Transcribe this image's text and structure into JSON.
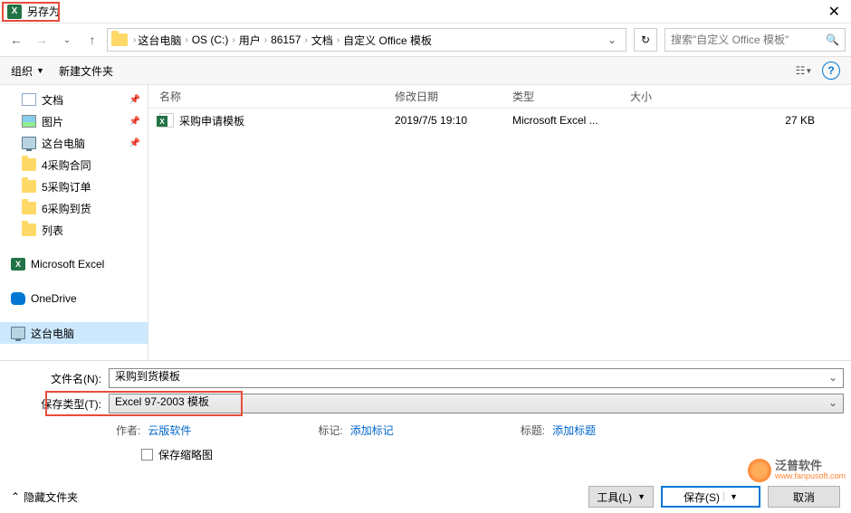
{
  "title": "另存为",
  "breadcrumb": [
    "这台电脑",
    "OS (C:)",
    "用户",
    "86157",
    "文档",
    "自定义 Office 模板"
  ],
  "search": {
    "placeholder": "搜索\"自定义 Office 模板\""
  },
  "toolbar": {
    "organize": "组织",
    "new_folder": "新建文件夹"
  },
  "sidebar": {
    "items": [
      {
        "label": "文档",
        "icon": "doc",
        "pinned": true
      },
      {
        "label": "图片",
        "icon": "pic",
        "pinned": true
      },
      {
        "label": "这台电脑",
        "icon": "pc",
        "pinned": true
      },
      {
        "label": "4采购合同",
        "icon": "folder"
      },
      {
        "label": "5采购订单",
        "icon": "folder"
      },
      {
        "label": "6采购到货",
        "icon": "folder"
      },
      {
        "label": "列表",
        "icon": "folder"
      },
      {
        "label": "Microsoft Excel",
        "icon": "excel"
      },
      {
        "label": "OneDrive",
        "icon": "onedrive"
      },
      {
        "label": "这台电脑",
        "icon": "pc",
        "selected": true
      }
    ]
  },
  "columns": {
    "name": "名称",
    "date": "修改日期",
    "type": "类型",
    "size": "大小"
  },
  "files": [
    {
      "name": "采购申请模板",
      "date": "2019/7/5 19:10",
      "type": "Microsoft Excel ...",
      "size": "27 KB"
    }
  ],
  "form": {
    "filename_label": "文件名(N):",
    "filename_value": "采购到货模板",
    "filetype_label": "保存类型(T):",
    "filetype_value": "Excel 97-2003 模板"
  },
  "meta": {
    "author_label": "作者:",
    "author_value": "云版软件",
    "tag_label": "标记:",
    "tag_value": "添加标记",
    "title_label": "标题:",
    "title_value": "添加标题"
  },
  "thumbnail_label": "保存缩略图",
  "bottom": {
    "hide_folders": "隐藏文件夹",
    "tools": "工具(L)",
    "save": "保存(S)",
    "cancel": "取消"
  },
  "watermark": {
    "cn": "泛普软件",
    "en": "www.fanpusoft.com"
  }
}
